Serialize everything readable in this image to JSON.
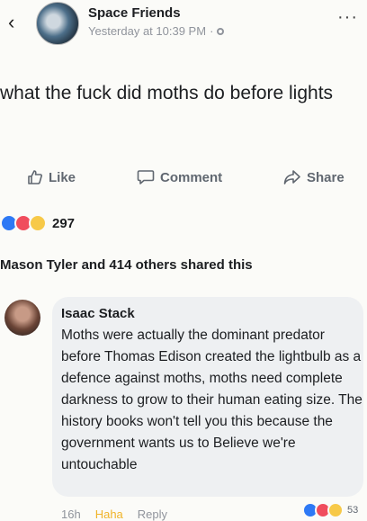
{
  "header": {
    "back_icon": "‹",
    "page_name": "Space Friends",
    "timestamp": "Yesterday at 10:39 PM",
    "dot_sep": "·",
    "more": "···"
  },
  "post": {
    "text": "what the fuck did moths do before lights"
  },
  "actions": {
    "like": "Like",
    "comment": "Comment",
    "share": "Share"
  },
  "reactions": {
    "count": "297",
    "colors": {
      "like": "#2e79f5",
      "love": "#f04d5d",
      "wow": "#f7c948"
    }
  },
  "shares": {
    "text": "Mason Tyler and 414 others shared this"
  },
  "comment": {
    "author": "Isaac Stack",
    "text": "Moths were actually the dominant predator before Thomas Edison created the lightbulb as a defence against moths, moths need complete darkness to grow to their human eating size. The history books won't tell you this because the government wants us to Believe we're untouchable",
    "time": "16h",
    "haha": "Haha",
    "reply": "Reply",
    "reaction_count": "53"
  }
}
